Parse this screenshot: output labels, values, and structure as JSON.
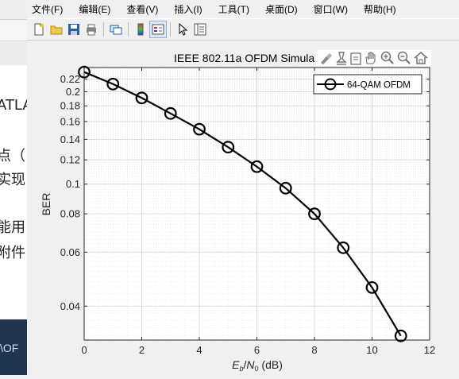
{
  "background": {
    "text_lines": [
      "ATLA",
      "点（",
      "实现",
      "能用",
      "附件"
    ],
    "bottom_text": "\\OF"
  },
  "menubar": {
    "items": [
      "文件(F)",
      "编辑(E)",
      "查看(V)",
      "插入(I)",
      "工具(T)",
      "桌面(D)",
      "窗口(W)",
      "帮助(H)"
    ]
  },
  "toolbar": {
    "buttons": [
      "new-figure-icon",
      "open-icon",
      "save-icon",
      "print-icon",
      "link-icon",
      "colorbar-icon",
      "legend-icon",
      "pointer-icon",
      "property-editor-icon"
    ]
  },
  "axes_toolbar": {
    "buttons": [
      "brush-icon",
      "data-tips-icon",
      "export-icon",
      "pan-icon",
      "zoom-in-icon",
      "zoom-out-icon",
      "home-icon"
    ]
  },
  "chart_data": {
    "type": "line",
    "title": "IEEE 802.11a OFDM Simula",
    "xlabel": "E_b/N_0 (dB)",
    "ylabel": "BER",
    "xlim": [
      0,
      12
    ],
    "ylim": [
      0.031,
      0.24
    ],
    "yscale": "log",
    "grid": true,
    "minor_grid": true,
    "legend_position": "top-right",
    "x_ticks": [
      "0",
      "2",
      "4",
      "6",
      "8",
      "10",
      "12"
    ],
    "y_ticks": [
      "0.04",
      "0.06",
      "0.08",
      "0.1",
      "0.12",
      "0.14",
      "0.16",
      "0.18",
      "0.2",
      "0.22"
    ],
    "y_tick_values": [
      0.04,
      0.06,
      0.08,
      0.1,
      0.12,
      0.14,
      0.16,
      0.18,
      0.2,
      0.22
    ],
    "series": [
      {
        "name": "64-QAM OFDM",
        "color": "#000000",
        "marker": "circle",
        "x": [
          0,
          1,
          2,
          3,
          4,
          5,
          6,
          7,
          8,
          9,
          10,
          11
        ],
        "values": [
          0.232,
          0.212,
          0.191,
          0.17,
          0.151,
          0.132,
          0.114,
          0.097,
          0.08,
          0.062,
          0.046,
          0.032
        ]
      }
    ]
  }
}
